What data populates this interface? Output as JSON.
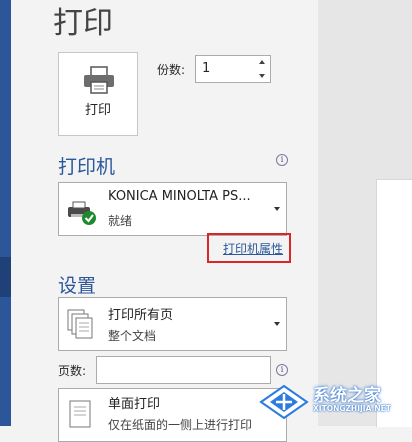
{
  "header": {
    "title": "打印"
  },
  "print_button": {
    "label": "打印"
  },
  "copies": {
    "label": "份数:",
    "value": "1"
  },
  "printer": {
    "section_title": "打印机",
    "name": "KONICA MINOLTA PS...",
    "status": "就绪",
    "properties_link": "打印机属性"
  },
  "settings": {
    "section_title": "设置",
    "range": {
      "title": "打印所有页",
      "subtitle": "整个文档"
    },
    "pages_label": "页数:",
    "sides": {
      "title": "单面打印",
      "subtitle": "仅在纸面的一侧上进行打印"
    }
  },
  "watermark": {
    "text": "系统之家",
    "subtext": "XITONGZHIJIA.NET"
  },
  "colors": {
    "accent": "#2b579a",
    "highlight": "#d92626",
    "sidebar": "#2b579a"
  },
  "icons": [
    "printer-icon",
    "printer-status-icon",
    "info-icon",
    "pages-icon",
    "single-sided-icon",
    "chevron-down-icon"
  ]
}
